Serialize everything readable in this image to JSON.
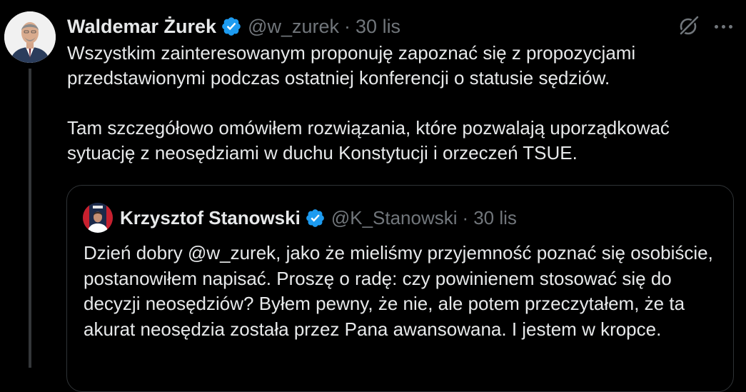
{
  "tweet": {
    "author_name": "Waldemar Żurek",
    "handle": "@w_zurek",
    "separator": "·",
    "date": "30 lis",
    "paragraphs": [
      "Wszystkim zainteresowanym proponuję zapoznać się z propozycjami przedstawionymi podczas ostatniej konferencji o statusie sędziów.",
      "Tam szczegółowo omówiłem rozwiązania, które pozwalają uporządkować sytuację z neosędziami w duchu Konstytucji i orzeczeń TSUE."
    ],
    "icons": {
      "verified": "verified-badge-icon",
      "grok": "grok-icon",
      "more": "more-options-icon"
    }
  },
  "quoted_tweet": {
    "author_name": "Krzysztof Stanowski",
    "handle": "@K_Stanowski",
    "separator": "·",
    "date": "30 lis",
    "text": "Dzień dobry @w_zurek, jako że mieliśmy przyjemność poznać się osobiście, postanowiłem napisać. Proszę o radę: czy powinienem stosować się do decyzji neosędziów? Byłem pewny, że nie, ale potem przeczytałem, że ta akurat neosędzia została przez Pana awansowana. I jestem w kropce."
  },
  "colors": {
    "background": "#000000",
    "text_primary": "#e7e9ea",
    "text_secondary": "#71767b",
    "verified_blue": "#1d9bf0",
    "border": "#2f3336"
  }
}
